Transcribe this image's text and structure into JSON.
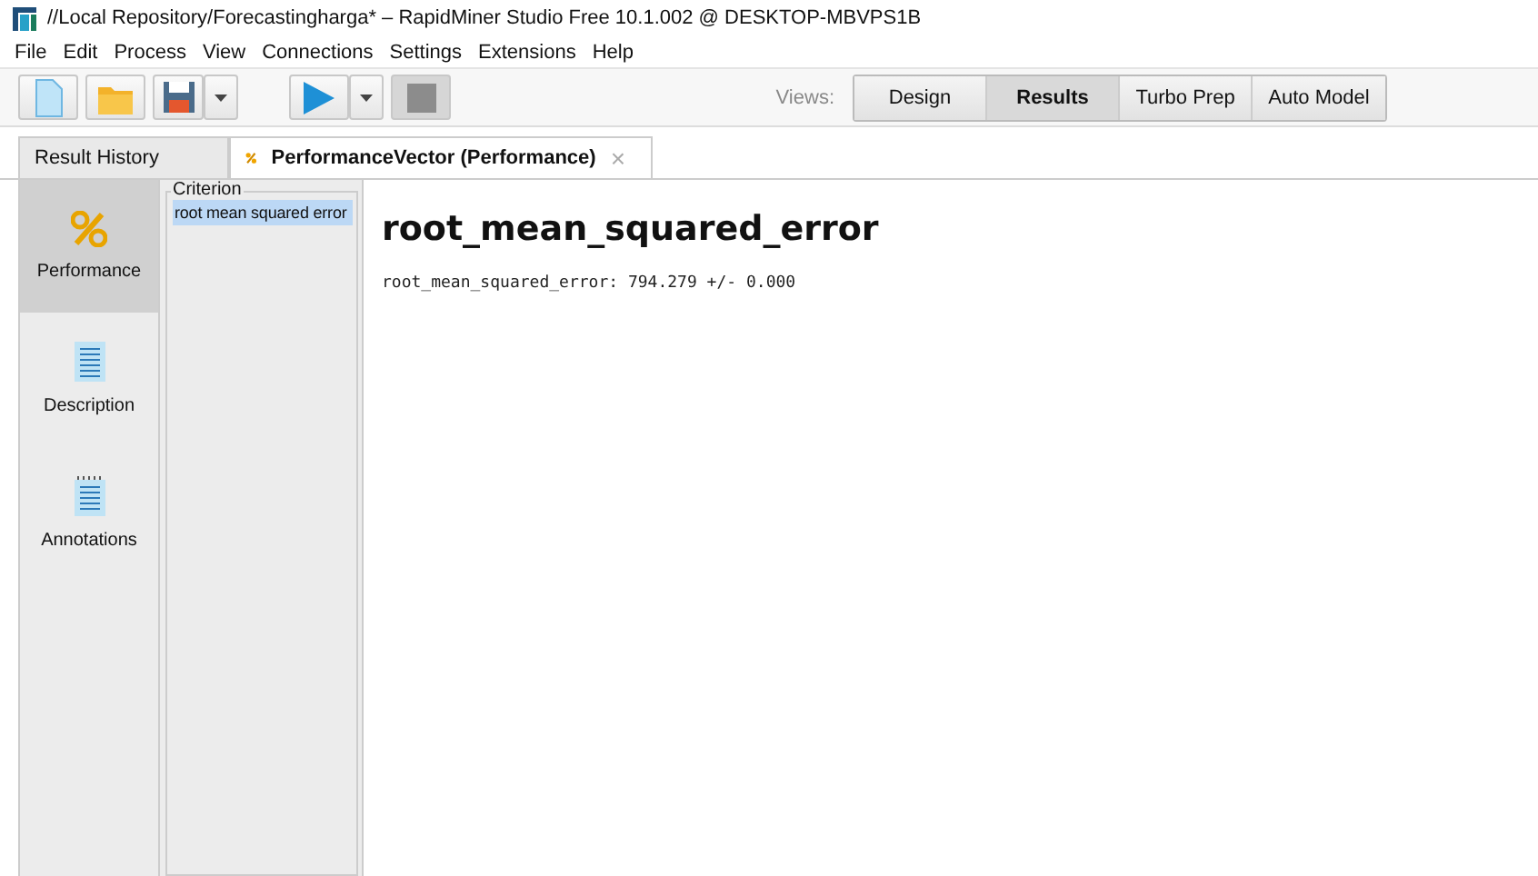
{
  "window": {
    "title": "//Local Repository/Forecastingharga* – RapidMiner Studio Free 10.1.002 @ DESKTOP-MBVPS1B"
  },
  "menu": [
    "File",
    "Edit",
    "Process",
    "View",
    "Connections",
    "Settings",
    "Extensions",
    "Help"
  ],
  "views": {
    "label": "Views:",
    "items": [
      {
        "label": "Design",
        "selected": false
      },
      {
        "label": "Results",
        "selected": true
      },
      {
        "label": "Turbo Prep",
        "selected": false
      },
      {
        "label": "Auto Model",
        "selected": false
      }
    ]
  },
  "tabs": [
    {
      "label": "Result History",
      "selected": false
    },
    {
      "label": "PerformanceVector (Performance)",
      "selected": true,
      "close": "×"
    }
  ],
  "sidebar": {
    "items": [
      {
        "label": "Performance",
        "kind": "percent",
        "selected": true
      },
      {
        "label": "Description",
        "kind": "document",
        "selected": false
      },
      {
        "label": "Annotations",
        "kind": "notes",
        "selected": false
      }
    ]
  },
  "criterion": {
    "title": "Criterion",
    "items": [
      {
        "label": "root mean squared error",
        "selected": true
      }
    ]
  },
  "result": {
    "heading": "root_mean_squared_error",
    "value": "root_mean_squared_error: 794.279 +/- 0.000"
  }
}
